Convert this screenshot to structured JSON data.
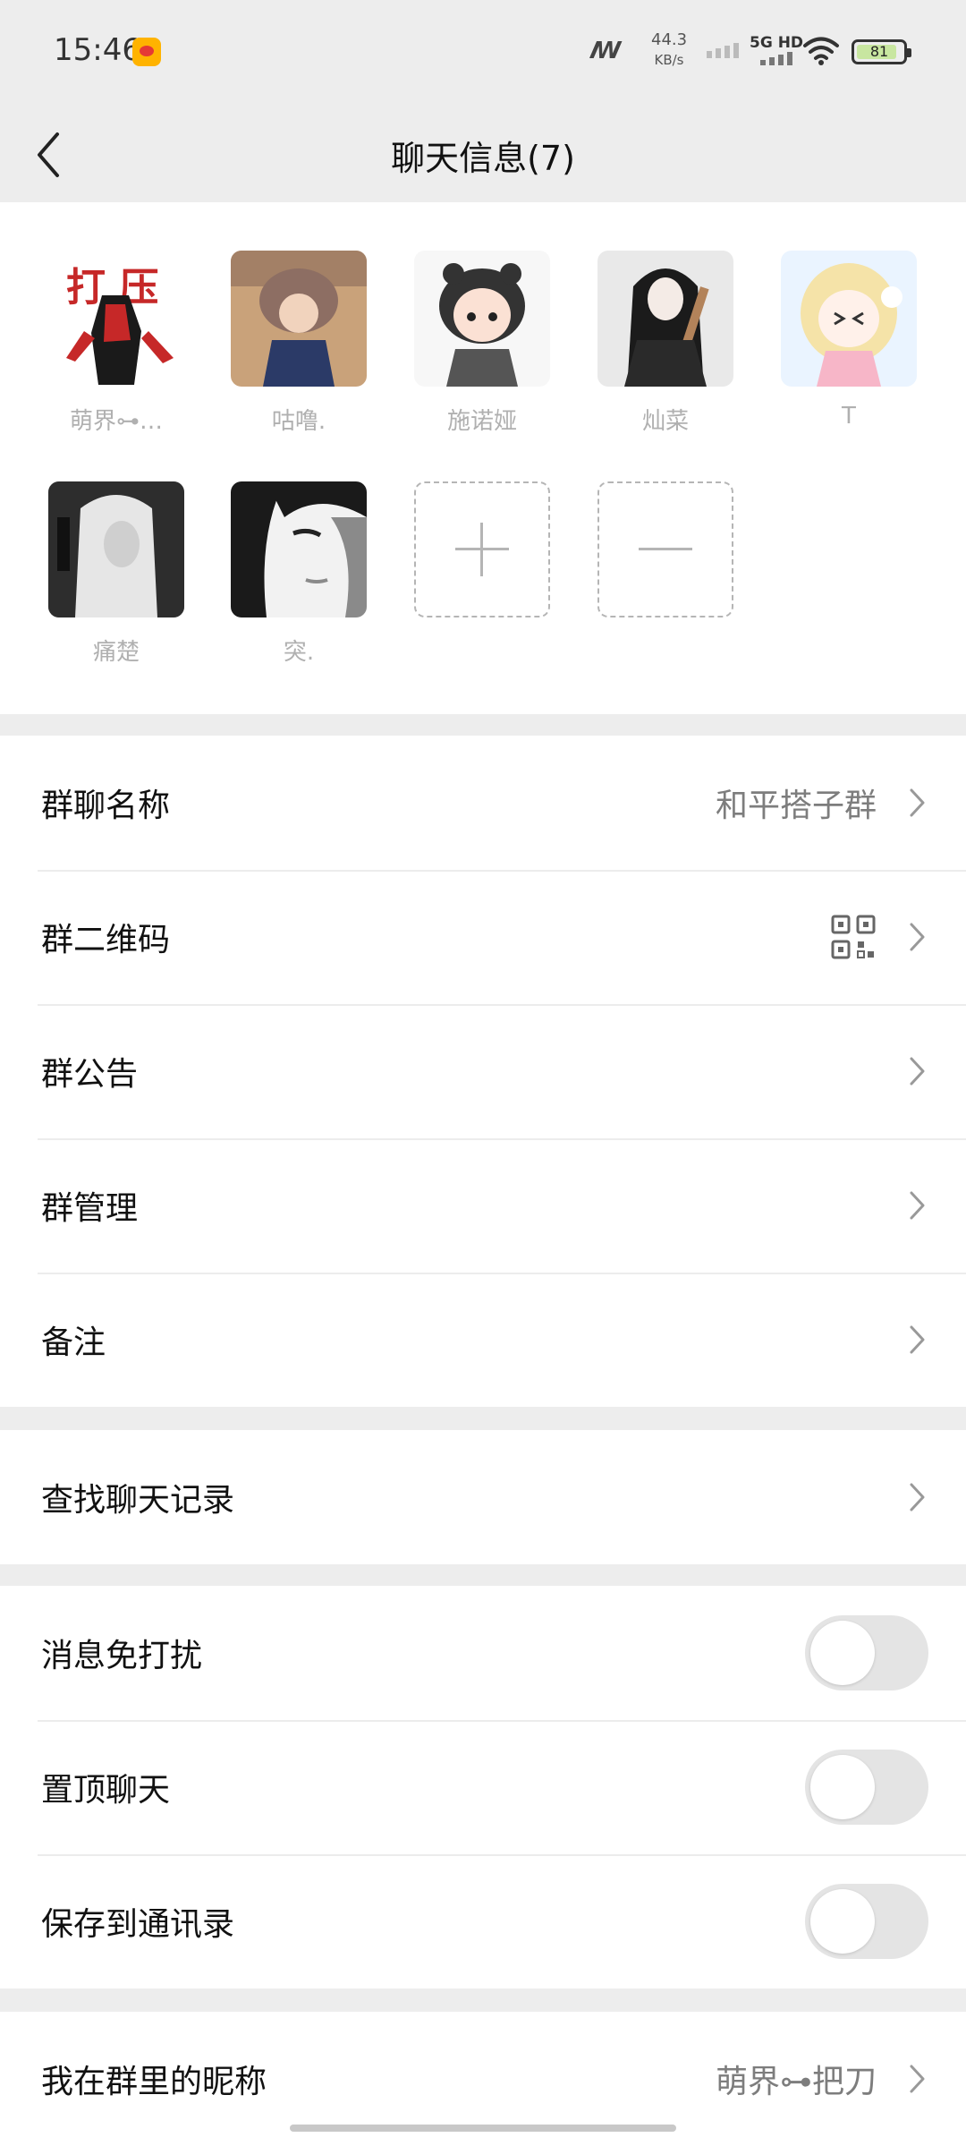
{
  "status_bar": {
    "time": "15:46",
    "net_speed_value": "44.3",
    "net_speed_unit": "KB/s",
    "network_type": "5G HD",
    "battery_level": "81",
    "icons": [
      "weibo-icon",
      "operator-logo-icon",
      "signal-icon",
      "wifi-icon",
      "battery-icon"
    ]
  },
  "header": {
    "title": "聊天信息(7)",
    "back_icon": "chevron-left-icon"
  },
  "members": [
    {
      "name": "萌界⊶…",
      "avatar_colors": [
        "#ffffff",
        "#c62828",
        "#1a1a1a"
      ]
    },
    {
      "name": "咕噜.",
      "avatar_colors": [
        "#8d6e63",
        "#2b3a67",
        "#c9a27a"
      ]
    },
    {
      "name": "施诺娅",
      "avatar_colors": [
        "#f7f7f7",
        "#333333",
        "#fbe1d4"
      ]
    },
    {
      "name": "灿菜",
      "avatar_colors": [
        "#e9e9e9",
        "#1b1b1b",
        "#b3835a"
      ]
    },
    {
      "name": "T",
      "avatar_colors": [
        "#eaf4ff",
        "#f5e3a8",
        "#f7b6c8"
      ]
    },
    {
      "name": "痛楚",
      "avatar_colors": [
        "#3a3a3a",
        "#e6e6e6",
        "#1a1a1a"
      ]
    },
    {
      "name": "突.",
      "avatar_colors": [
        "#f2f2f2",
        "#1a1a1a",
        "#8a8a8a"
      ]
    }
  ],
  "member_actions": {
    "add_icon": "plus-icon",
    "remove_icon": "minus-icon"
  },
  "settings": {
    "group1": [
      {
        "label": "群聊名称",
        "value": "和平搭子群",
        "type": "link"
      },
      {
        "label": "群二维码",
        "value": "",
        "type": "qr"
      },
      {
        "label": "群公告",
        "value": "",
        "type": "link"
      },
      {
        "label": "群管理",
        "value": "",
        "type": "link"
      },
      {
        "label": "备注",
        "value": "",
        "type": "link"
      }
    ],
    "group2": [
      {
        "label": "查找聊天记录",
        "value": "",
        "type": "link"
      }
    ],
    "group3": [
      {
        "label": "消息免打扰",
        "on": false
      },
      {
        "label": "置顶聊天",
        "on": false
      },
      {
        "label": "保存到通讯录",
        "on": false
      }
    ],
    "group4": [
      {
        "label": "我在群里的昵称",
        "value": "萌界⊶把刀",
        "type": "link"
      }
    ]
  },
  "colors": {
    "background": "#ededed",
    "card": "#ffffff",
    "text": "#111111",
    "secondary_text": "#7d7d7d",
    "member_name": "#b0b0b0",
    "toggle_off": "#e4e4e4"
  }
}
